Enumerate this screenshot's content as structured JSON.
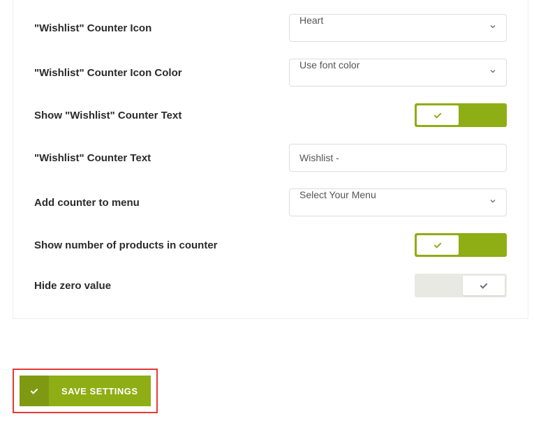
{
  "fields": {
    "counter_icon": {
      "label": "\"Wishlist\" Counter Icon",
      "value": "Heart"
    },
    "counter_icon_color": {
      "label": "\"Wishlist\" Counter Icon Color",
      "value": "Use font color"
    },
    "show_counter_text": {
      "label": "Show \"Wishlist\" Counter Text",
      "value": true
    },
    "counter_text": {
      "label": "\"Wishlist\" Counter Text",
      "value": "Wishlist -"
    },
    "add_to_menu": {
      "label": "Add counter to menu",
      "value": "Select Your Menu"
    },
    "show_count": {
      "label": "Show number of products in counter",
      "value": true
    },
    "hide_zero": {
      "label": "Hide zero value",
      "value": false
    }
  },
  "save_button": "SAVE SETTINGS",
  "colors": {
    "accent": "#8fad14",
    "highlight_border": "#e53935"
  }
}
